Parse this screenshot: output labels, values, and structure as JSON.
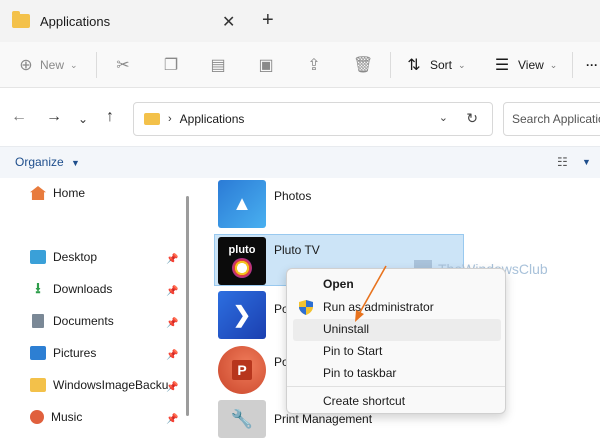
{
  "tab": {
    "title": "Applications",
    "close": "✕",
    "new": "+"
  },
  "toolbar": {
    "new_label": "New",
    "sort_label": "Sort",
    "view_label": "View",
    "more": "···"
  },
  "address": {
    "path": "Applications",
    "search_placeholder": "Search Applications"
  },
  "organize": {
    "label": "Organize"
  },
  "nav": {
    "home": "Home",
    "items": [
      {
        "label": "Desktop",
        "icon": "desktop-icon"
      },
      {
        "label": "Downloads",
        "icon": "download-icon"
      },
      {
        "label": "Documents",
        "icon": "document-icon"
      },
      {
        "label": "Pictures",
        "icon": "pictures-icon"
      },
      {
        "label": "WindowsImageBacku",
        "icon": "folder-icon"
      },
      {
        "label": "Music",
        "icon": "music-icon"
      }
    ]
  },
  "apps": [
    {
      "label": "Photos"
    },
    {
      "label": "Pluto TV"
    },
    {
      "label": "Po"
    },
    {
      "label": "Po"
    },
    {
      "label": "Print Management"
    }
  ],
  "context_menu": {
    "open": "Open",
    "run_admin": "Run as administrator",
    "uninstall": "Uninstall",
    "pin_start": "Pin to Start",
    "pin_taskbar": "Pin to taskbar",
    "create_shortcut": "Create shortcut"
  },
  "watermark": "TheWindowsClub",
  "colors": {
    "accent": "#1e4e8c",
    "selection": "#cce4f7",
    "arrow": "#e8731e",
    "folder": "#f3c14a"
  }
}
